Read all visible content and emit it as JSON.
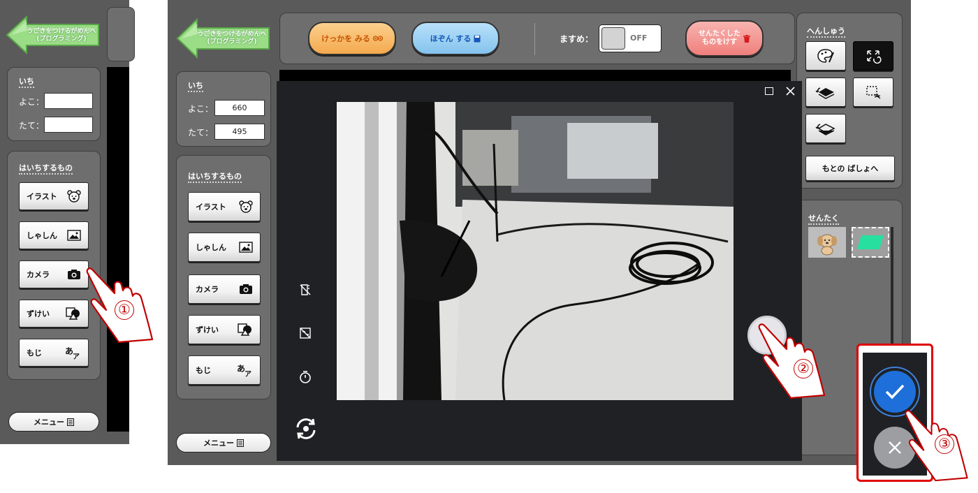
{
  "app": {
    "back_button_line1": "うごきをつけるがめんへ",
    "back_button_line2": "(プログラミング)",
    "menu_label": "メニュー",
    "position": {
      "title": "いち",
      "x_label": "よこ：",
      "y_label": "たて："
    },
    "left_screen": {
      "x_value": "",
      "y_value": ""
    },
    "right_screen": {
      "x_value": "660",
      "y_value": "495"
    },
    "place_items": {
      "title": "はいちするもの",
      "items": [
        {
          "label": "イラスト",
          "icon": "bear-icon"
        },
        {
          "label": "しゃしん",
          "icon": "picture-icon"
        },
        {
          "label": "カメラ",
          "icon": "camera-icon"
        },
        {
          "label": "ずけい",
          "icon": "shapes-icon"
        },
        {
          "label": "もじ",
          "icon": "text-icon"
        }
      ]
    }
  },
  "toolbar": {
    "view_result_label": "けっかを みる",
    "save_label": "ほぞん する",
    "grid_label": "ますめ：",
    "grid_toggle": "OFF",
    "delete_line1": "せんたくした",
    "delete_line2": "ものをけす"
  },
  "edit_panel": {
    "title": "へんしゅう",
    "reset_position_label": "もとの ばしょへ"
  },
  "selection_panel": {
    "title": "せんたく"
  },
  "camera": {
    "left_icons": [
      "flash-off-icon",
      "hdr-off-icon",
      "timer-icon",
      "switch-camera-icon"
    ],
    "window_icons": [
      "maximize-icon",
      "close-icon"
    ]
  },
  "callouts": [
    "①",
    "②",
    "③"
  ],
  "colors": {
    "frame": "#5a5a5a",
    "panel": "#6e6e6e",
    "arrow_green": "#8fd47b",
    "result_orange": "#f6b25b",
    "save_blue": "#8ec8ee",
    "delete_red": "#f08b88",
    "confirm_blue": "#1e6fd9",
    "highlight_red": "#e00000"
  }
}
